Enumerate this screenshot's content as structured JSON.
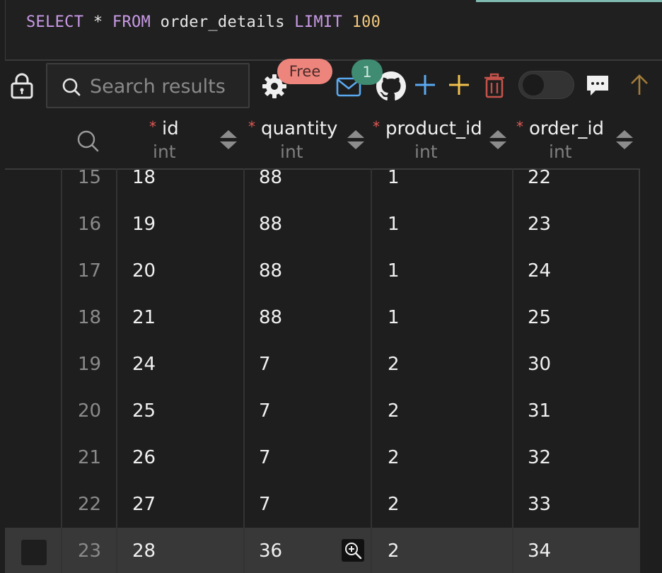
{
  "editor": {
    "sql_tokens": {
      "select": "SELECT",
      "star": "*",
      "from": "FROM",
      "table": "order_details",
      "limit": "LIMIT",
      "limit_value": "100"
    }
  },
  "toolbar": {
    "search_placeholder": "Search results",
    "free_badge": "Free",
    "mail_count": "1",
    "icons": [
      "lock-icon",
      "search-icon",
      "gear-icon",
      "mail-icon",
      "github-icon",
      "plus-blue-icon",
      "plus-yellow-icon",
      "trash-icon",
      "toggle",
      "comment-icon",
      "arrow-up-icon"
    ],
    "colors": {
      "blue": "#5aa9f0",
      "yellow": "#f2c14e",
      "red": "#c5524a",
      "gold": "#a27c3b"
    }
  },
  "grid": {
    "columns": [
      {
        "name": "id",
        "type": "int",
        "required": "*"
      },
      {
        "name": "quantity",
        "type": "int",
        "required": "*"
      },
      {
        "name": "product_id",
        "type": "int",
        "required": "*"
      },
      {
        "name": "order_id",
        "type": "int",
        "required": "*"
      }
    ],
    "rows": [
      {
        "num": "15",
        "id": "18",
        "quantity": "88",
        "product_id": "1",
        "order_id": "22"
      },
      {
        "num": "16",
        "id": "19",
        "quantity": "88",
        "product_id": "1",
        "order_id": "23"
      },
      {
        "num": "17",
        "id": "20",
        "quantity": "88",
        "product_id": "1",
        "order_id": "24"
      },
      {
        "num": "18",
        "id": "21",
        "quantity": "88",
        "product_id": "1",
        "order_id": "25"
      },
      {
        "num": "19",
        "id": "24",
        "quantity": "7",
        "product_id": "2",
        "order_id": "30"
      },
      {
        "num": "20",
        "id": "25",
        "quantity": "7",
        "product_id": "2",
        "order_id": "31"
      },
      {
        "num": "21",
        "id": "26",
        "quantity": "7",
        "product_id": "2",
        "order_id": "32"
      },
      {
        "num": "22",
        "id": "27",
        "quantity": "7",
        "product_id": "2",
        "order_id": "33"
      },
      {
        "num": "23",
        "id": "28",
        "quantity": "36",
        "product_id": "2",
        "order_id": "34"
      }
    ],
    "selected_row_index": 8
  }
}
